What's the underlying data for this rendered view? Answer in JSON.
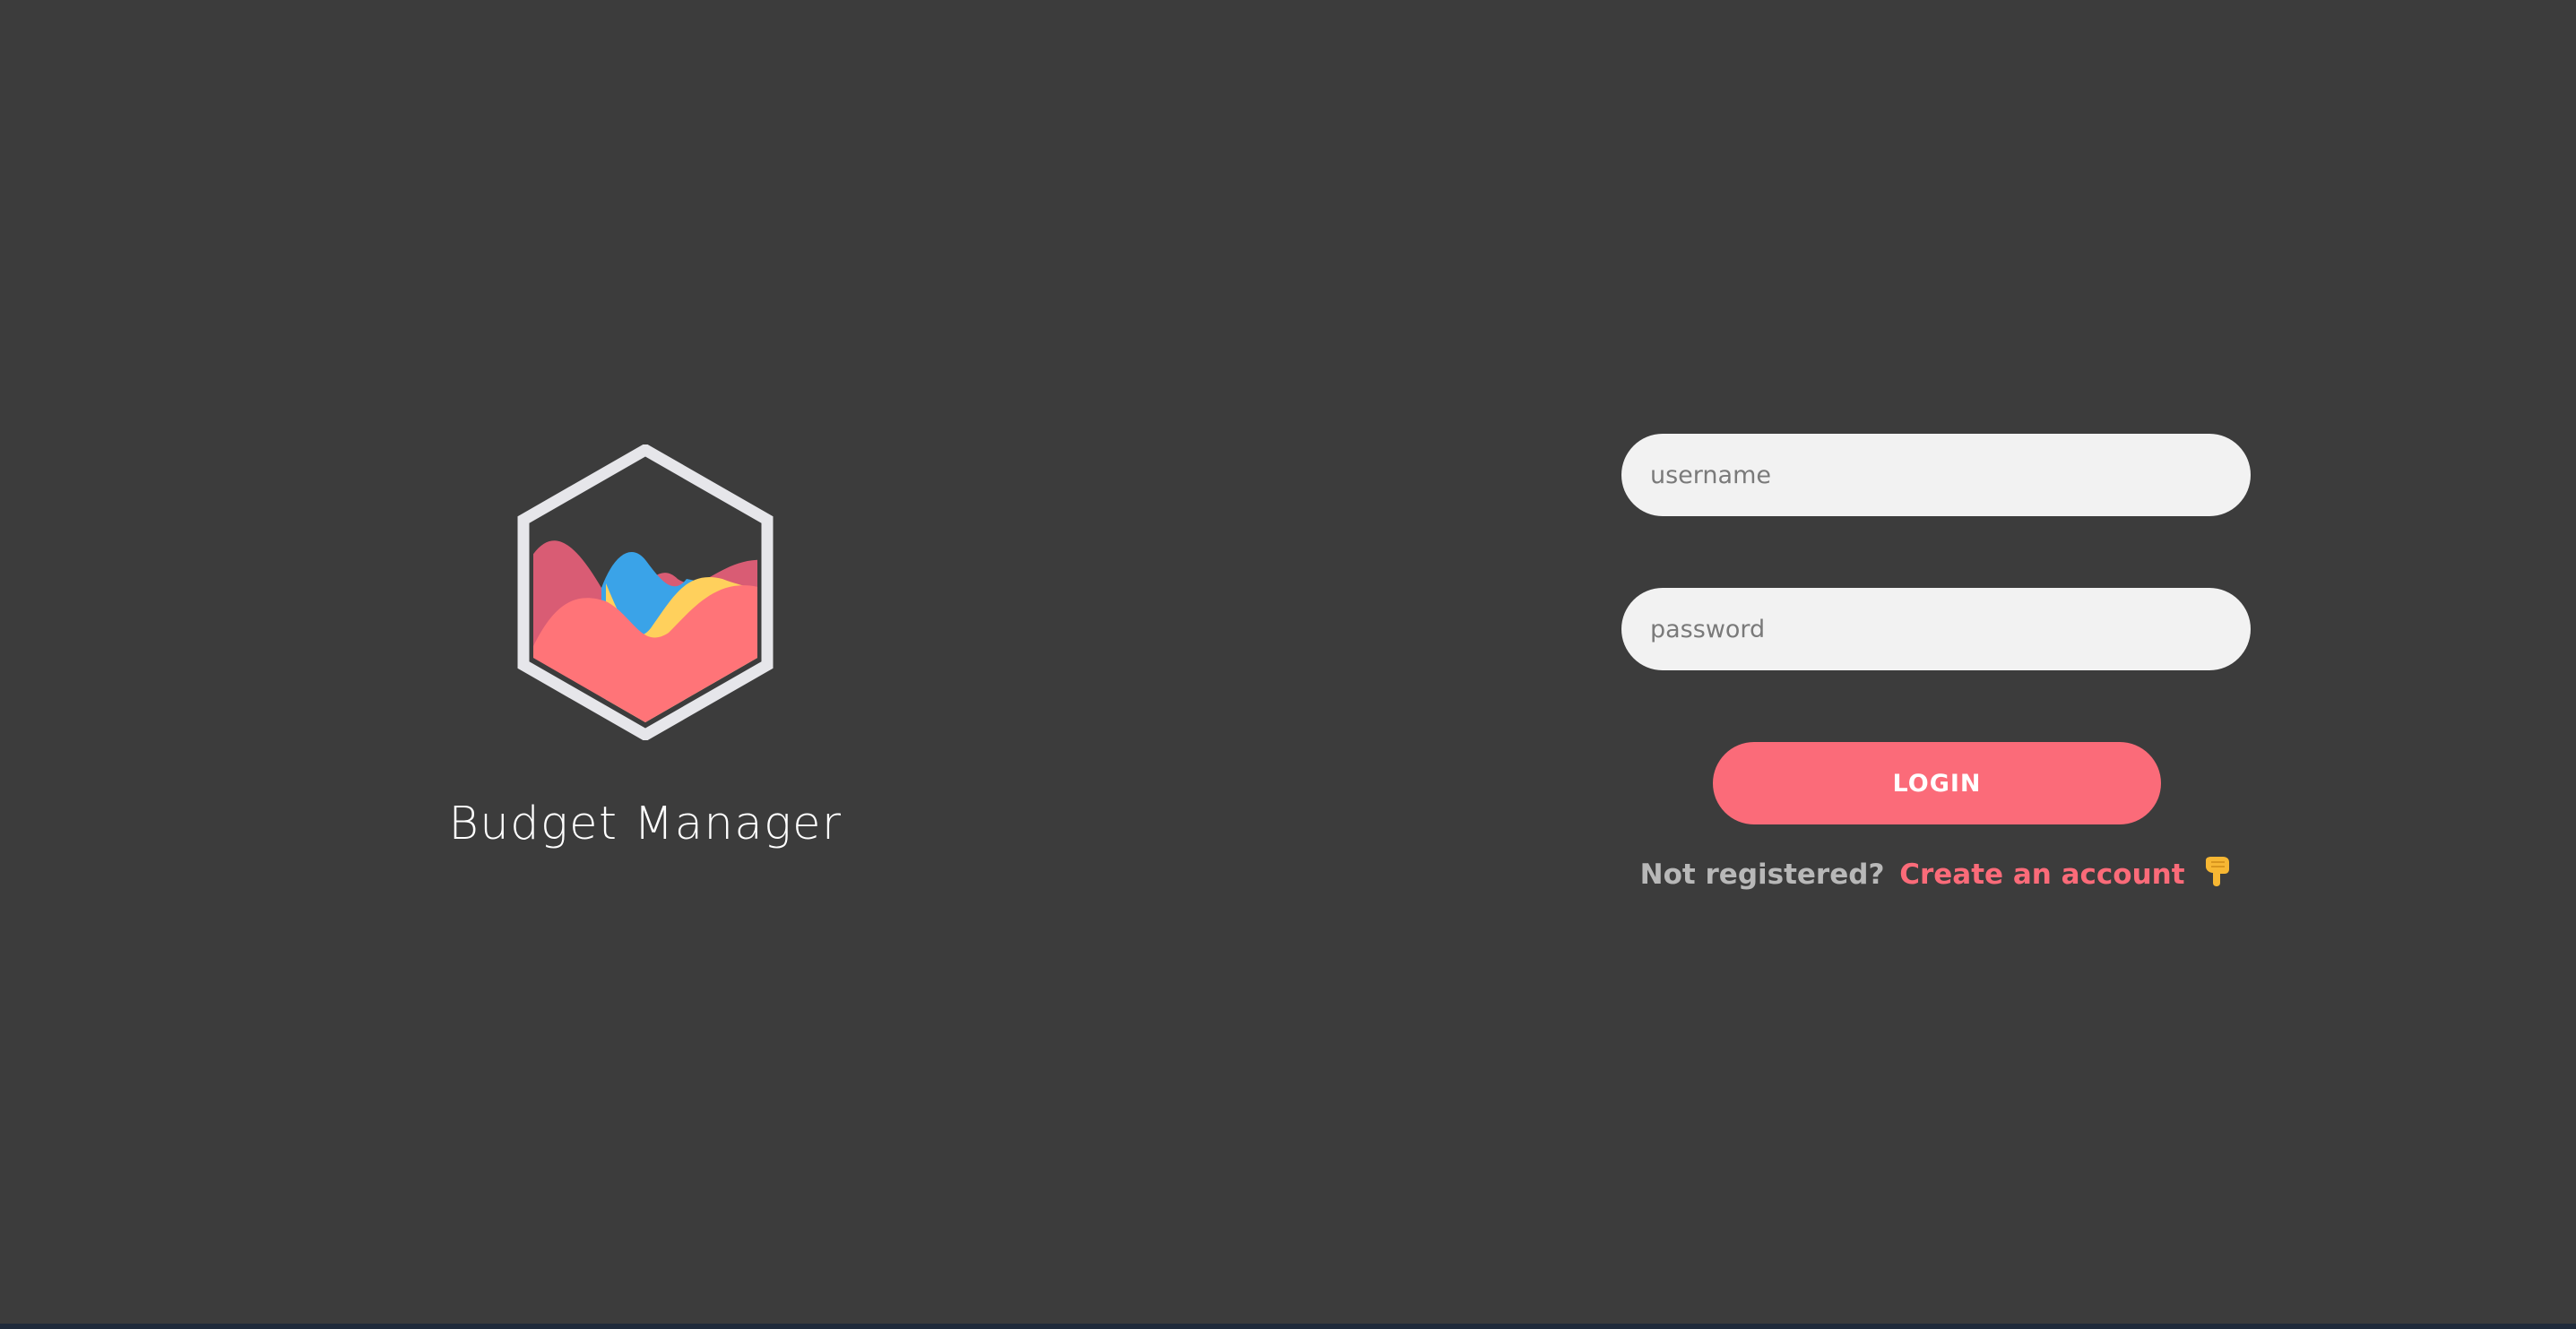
{
  "app": {
    "title": "Budget Manager",
    "logo_icon": "hexagon-chart-logo-icon"
  },
  "colors": {
    "background": "#3c3c3c",
    "field_background": "#f2f2f2",
    "accent": "#fb6b79",
    "muted_text": "#b8b8b8"
  },
  "login_form": {
    "username_placeholder": "username",
    "password_placeholder": "password",
    "login_button_label": "LOGIN",
    "register_prompt": "Not registered?",
    "register_link_label": "Create an account",
    "register_icon": "pointing-down-hand-icon"
  }
}
